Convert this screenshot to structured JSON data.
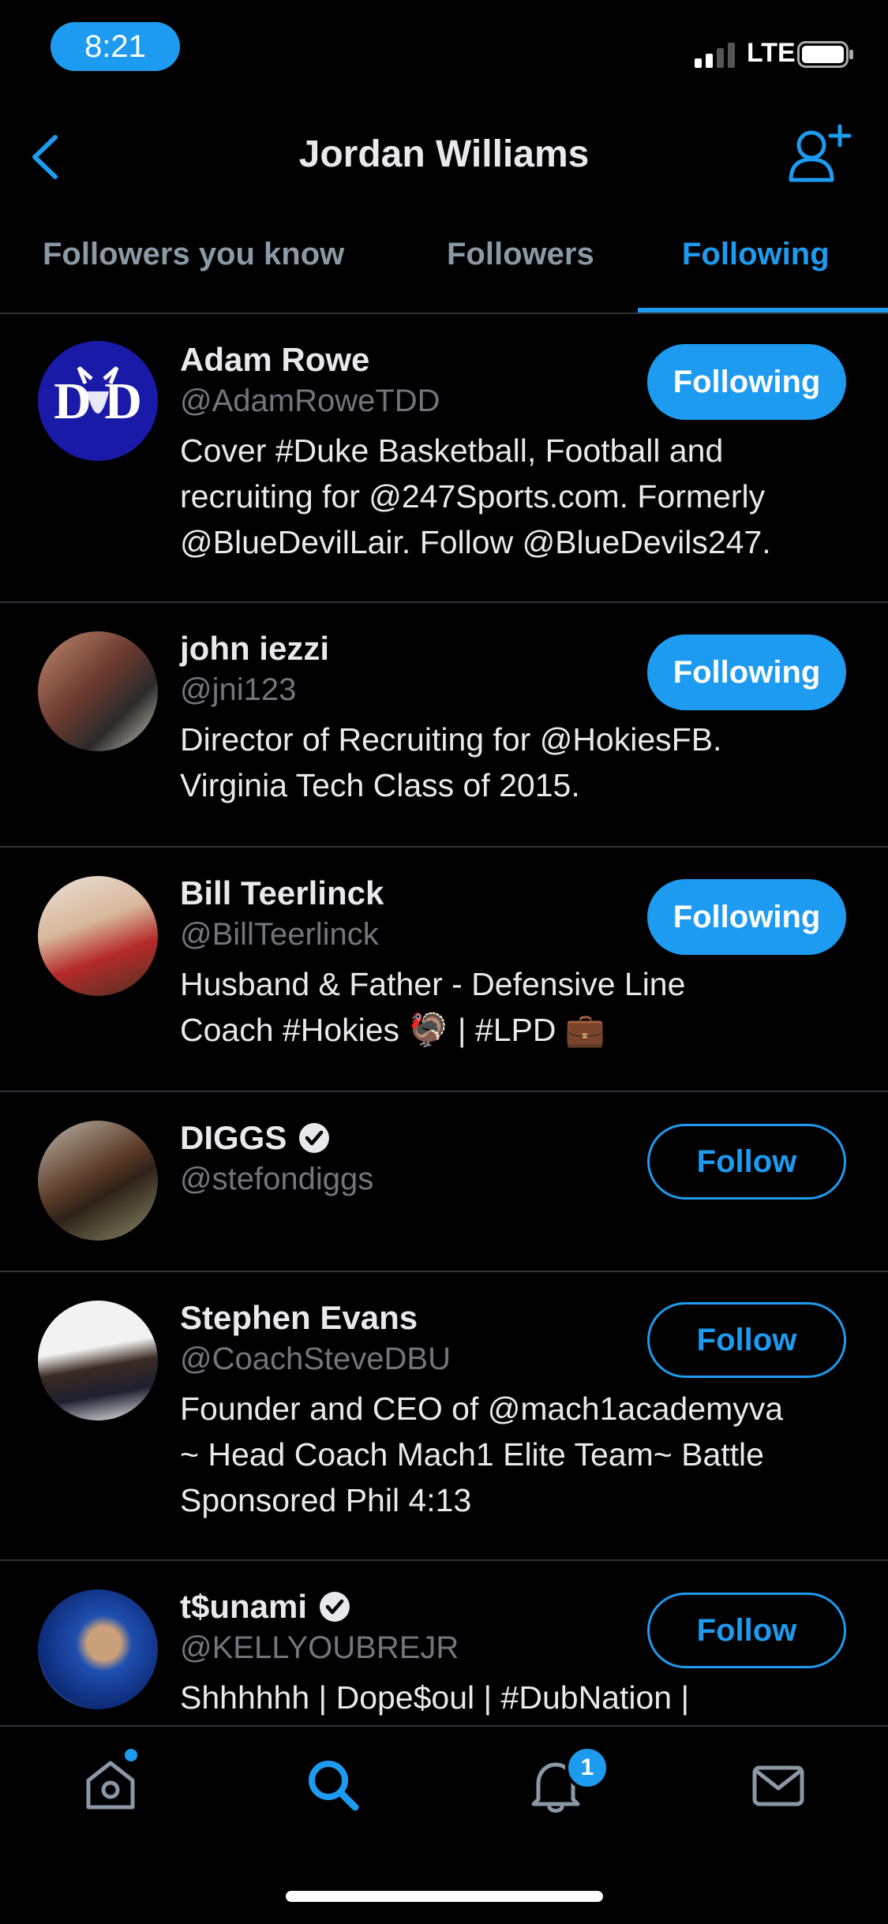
{
  "status_bar": {
    "time": "8:21",
    "network": "LTE"
  },
  "header": {
    "title": "Jordan Williams"
  },
  "tabs": [
    {
      "label": "Followers you know"
    },
    {
      "label": "Followers"
    },
    {
      "label": "Following"
    }
  ],
  "users": [
    {
      "name": "Adam Rowe",
      "handle": "@AdamRoweTDD",
      "verified": false,
      "bio_lines": [
        "Cover #Duke Basketball, Football and",
        "recruiting for @247Sports.com. Formerly",
        "@BlueDevilLair. Follow @BlueDevils247."
      ],
      "button": "Following"
    },
    {
      "name": "john iezzi",
      "handle": "@jni123",
      "verified": false,
      "bio_lines": [
        "Director of Recruiting for @HokiesFB.",
        "Virginia Tech Class of 2015."
      ],
      "button": "Following"
    },
    {
      "name": "Bill Teerlinck",
      "handle": "@BillTeerlinck",
      "verified": false,
      "bio_lines": [
        "Husband & Father - Defensive Line",
        "Coach #Hokies 🦃 | #LPD 💼"
      ],
      "button": "Following"
    },
    {
      "name": "DIGGS",
      "handle": "@stefondiggs",
      "verified": true,
      "bio_lines": [],
      "button": "Follow"
    },
    {
      "name": "Stephen Evans",
      "handle": "@CoachSteveDBU",
      "verified": false,
      "bio_lines": [
        "Founder and CEO of @mach1academyva",
        "~ Head Coach Mach1 Elite Team~ Battle",
        "Sponsored Phil 4:13"
      ],
      "button": "Follow"
    },
    {
      "name": "t$unami",
      "handle": "@KELLYOUBREJR",
      "verified": true,
      "bio_lines": [
        "Shhhhhh | Dope$oul | #DubNation |"
      ],
      "button": "Follow"
    }
  ],
  "nav": {
    "notification_count": "1"
  },
  "colors": {
    "accent": "#1d9bf0",
    "background": "#000000",
    "secondary_text": "#71767b"
  }
}
